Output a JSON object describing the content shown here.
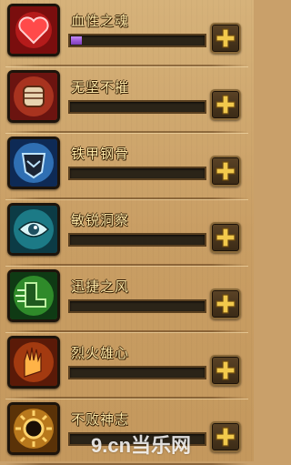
{
  "skills": [
    {
      "name": "血性之魂",
      "progress": 0.08,
      "icon": "blood-heart-icon"
    },
    {
      "name": "无坚不摧",
      "progress": 0,
      "icon": "fist-icon"
    },
    {
      "name": "铁甲钢骨",
      "progress": 0,
      "icon": "armor-icon"
    },
    {
      "name": "敏锐洞察",
      "progress": 0,
      "icon": "eye-insight-icon"
    },
    {
      "name": "迅捷之风",
      "progress": 0,
      "icon": "wind-boot-icon"
    },
    {
      "name": "烈火雄心",
      "progress": 0,
      "icon": "fire-hand-icon"
    },
    {
      "name": "不败神志",
      "progress": 0,
      "icon": "sun-sigil-icon"
    }
  ],
  "watermark": "9.cn当乐网",
  "colors": {
    "fill": "#9b57d6",
    "name_text": "#ffe9a8",
    "plus": "#f2c94c"
  }
}
